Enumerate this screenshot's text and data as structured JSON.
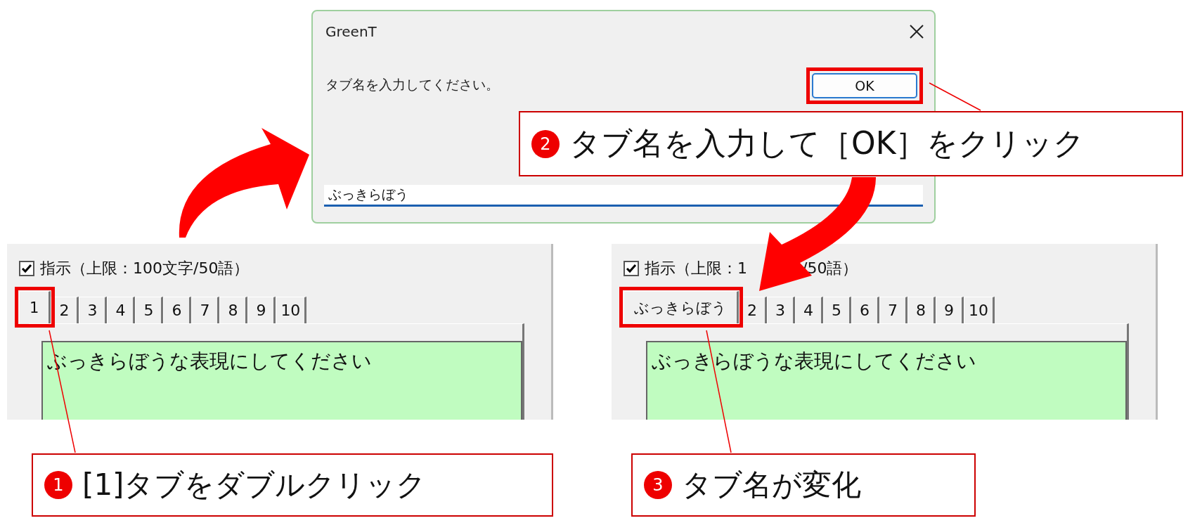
{
  "dialog": {
    "title": "GreenT",
    "message": "タブ名を入力してください。",
    "ok_button": "OK",
    "input_value": "ぶっきらぼう"
  },
  "panels": [
    {
      "checkbox": {
        "label_parts": [
          "指示（上限：100文字/50語）"
        ],
        "checked": true
      },
      "tabs": [
        {
          "label": "1",
          "selected": true
        },
        {
          "label": "2",
          "selected": false
        },
        {
          "label": "3",
          "selected": false
        },
        {
          "label": "4",
          "selected": false
        },
        {
          "label": "5",
          "selected": false
        },
        {
          "label": "6",
          "selected": false
        },
        {
          "label": "7",
          "selected": false
        },
        {
          "label": "8",
          "selected": false
        },
        {
          "label": "9",
          "selected": false
        },
        {
          "label": "10",
          "selected": false
        }
      ],
      "text": "ぶっきらぼうな表現にしてください"
    },
    {
      "checkbox": {
        "label_parts": [
          "指示（上限：1",
          "/50語）"
        ],
        "checked": true
      },
      "tabs": [
        {
          "label": "ぶっきらぼう",
          "selected": true
        },
        {
          "label": "2",
          "selected": false
        },
        {
          "label": "3",
          "selected": false
        },
        {
          "label": "4",
          "selected": false
        },
        {
          "label": "5",
          "selected": false
        },
        {
          "label": "6",
          "selected": false
        },
        {
          "label": "7",
          "selected": false
        },
        {
          "label": "8",
          "selected": false
        },
        {
          "label": "9",
          "selected": false
        },
        {
          "label": "10",
          "selected": false
        }
      ],
      "text": "ぶっきらぼうな表現にしてください"
    }
  ],
  "callouts": [
    {
      "number": "2",
      "text": "タブ名を入力して［OK］をクリック"
    },
    {
      "number": "1",
      "text": "[1]タブをダブルクリック"
    },
    {
      "number": "3",
      "text": "タブ名が変化"
    }
  ]
}
